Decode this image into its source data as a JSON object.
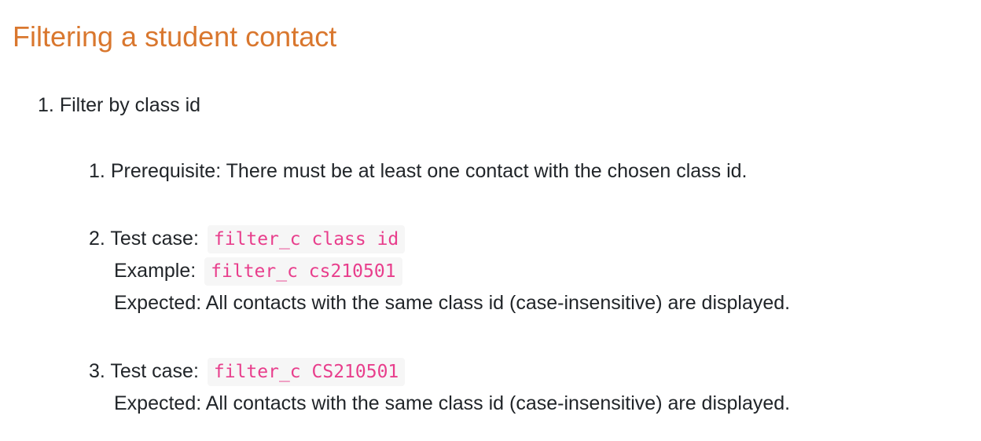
{
  "page": {
    "heading": "Filtering a student contact",
    "item1": {
      "number": "1.",
      "label": "Filter by class id",
      "subitems": [
        {
          "number": "1.",
          "text": "Prerequisite: There must be at least one contact with the chosen class id."
        },
        {
          "number": "2.",
          "test_label": "Test case:",
          "test_code": "filter_c class id",
          "example_label": "Example:",
          "example_code": "filter_c cs210501",
          "expected": "Expected: All contacts with the same class id (case-insensitive) are displayed."
        },
        {
          "number": "3.",
          "test_label": "Test case:",
          "test_code": "filter_c CS210501",
          "expected": "Expected: All contacts with the same class id (case-insensitive) are displayed."
        }
      ]
    }
  }
}
